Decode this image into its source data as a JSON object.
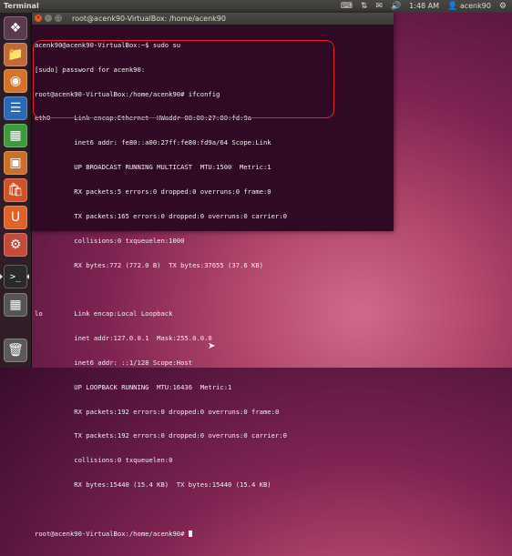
{
  "panel": {
    "app_title": "Terminal",
    "clock": "1:48 AM",
    "user": "acenk90"
  },
  "launcher": {
    "items": [
      {
        "name": "dash-home",
        "icon": "ubuntu-logo-icon",
        "color": "#5a3a50"
      },
      {
        "name": "files",
        "icon": "folder-icon",
        "color": "#c0693a"
      },
      {
        "name": "firefox",
        "icon": "firefox-icon",
        "color": "#d4732b"
      },
      {
        "name": "libreoffice-writer",
        "icon": "writer-icon",
        "color": "#2c68b5"
      },
      {
        "name": "libreoffice-calc",
        "icon": "calc-icon",
        "color": "#3d9a3d"
      },
      {
        "name": "libreoffice-impress",
        "icon": "impress-icon",
        "color": "#c9702a"
      },
      {
        "name": "software-center",
        "icon": "shopping-bag-icon",
        "color": "#d0522a"
      },
      {
        "name": "ubuntu-one",
        "icon": "ubuntu-one-icon",
        "color": "#e0632c"
      },
      {
        "name": "system-settings",
        "icon": "gear-icon",
        "color": "#c44a3a"
      },
      {
        "name": "terminal",
        "icon": "terminal-icon",
        "color": "#2a2a2a"
      },
      {
        "name": "workspace-switcher",
        "icon": "workspace-icon",
        "color": "#555555"
      },
      {
        "name": "trash",
        "icon": "trash-icon",
        "color": "#5a5a5a"
      }
    ]
  },
  "terminal": {
    "title": "root@acenk90-VirtualBox: /home/acenk90",
    "lines": [
      "acenk90@acenk90-VirtualBox:~$ sudo su",
      "[sudo] password for acenk90:",
      "root@acenk90-VirtualBox:/home/acenk90# ifconfig",
      "eth0      Link encap:Ethernet  HWaddr 08:00:27:80:fd:9a",
      "          inet6 addr: fe80::a00:27ff:fe80:fd9a/64 Scope:Link",
      "          UP BROADCAST RUNNING MULTICAST  MTU:1500  Metric:1",
      "          RX packets:5 errors:0 dropped:0 overruns:0 frame:0",
      "          TX packets:165 errors:0 dropped:0 overruns:0 carrier:0",
      "          collisions:0 txqueuelen:1000",
      "          RX bytes:772 (772.0 B)  TX bytes:37655 (37.6 KB)",
      "",
      "lo        Link encap:Local Loopback",
      "          inet addr:127.0.0.1  Mask:255.0.0.0",
      "          inet6 addr: ::1/128 Scope:Host",
      "          UP LOOPBACK RUNNING  MTU:16436  Metric:1",
      "          RX packets:192 errors:0 dropped:0 overruns:0 frame:0",
      "          TX packets:192 errors:0 dropped:0 overruns:0 carrier:0",
      "          collisions:0 txqueuelen:0",
      "          RX bytes:15440 (15.4 KB)  TX bytes:15440 (15.4 KB)",
      "",
      "root@acenk90-VirtualBox:/home/acenk90# "
    ]
  }
}
